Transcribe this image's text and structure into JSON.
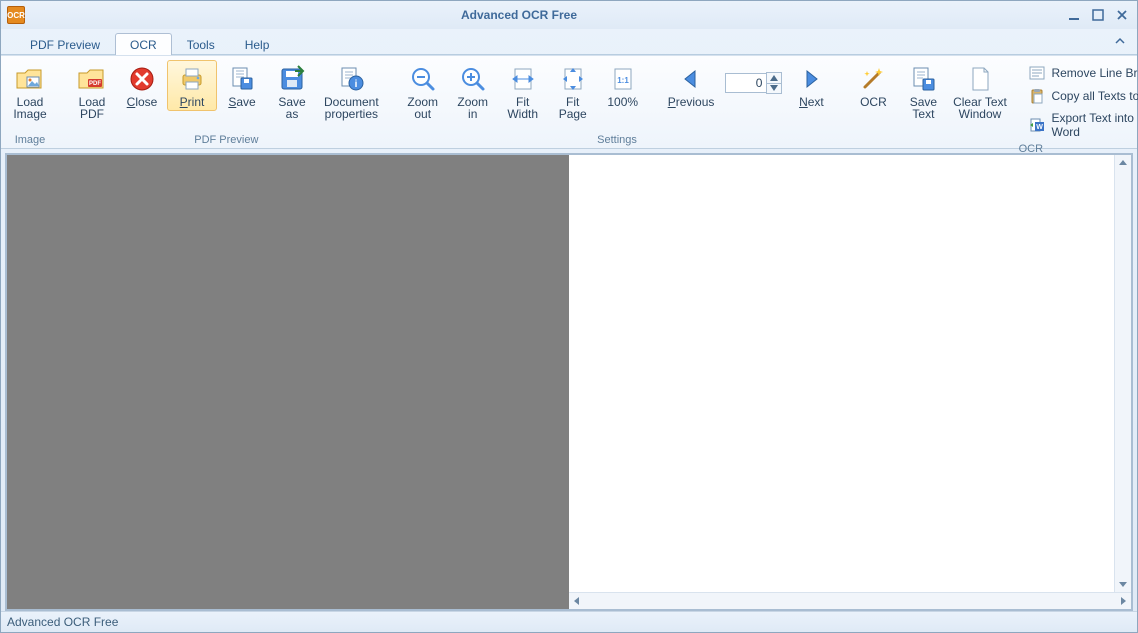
{
  "app": {
    "title": "Advanced OCR Free",
    "status": "Advanced OCR Free"
  },
  "tabs": [
    {
      "label": "PDF Preview",
      "active": false
    },
    {
      "label": "OCR",
      "active": true
    },
    {
      "label": "Tools",
      "active": false
    },
    {
      "label": "Help",
      "active": false
    }
  ],
  "ribbon": {
    "image": {
      "label": "Image",
      "load_image": "Load\nImage"
    },
    "pdf_preview": {
      "label": "PDF Preview",
      "load_pdf": "Load\nPDF",
      "close": "Close",
      "print": "Print",
      "save": "Save",
      "save_as": "Save\nas",
      "doc_props": "Document\nproperties"
    },
    "settings": {
      "label": "Settings",
      "zoom_out": "Zoom\nout",
      "zoom_in": "Zoom\nin",
      "fit_width": "Fit\nWidth",
      "fit_page": "Fit\nPage",
      "percent_100": "100%",
      "previous": "Previous",
      "page_value": "0",
      "next": "Next"
    },
    "ocr": {
      "label": "OCR",
      "ocr_btn": "OCR",
      "save_text": "Save\nText",
      "clear_text": "Clear Text\nWindow",
      "remove_breaks": "Remove Line Breaks",
      "copy_all": "Copy all Texts to Clipboard",
      "export_word": "Export Text into Microsoft Word"
    }
  }
}
